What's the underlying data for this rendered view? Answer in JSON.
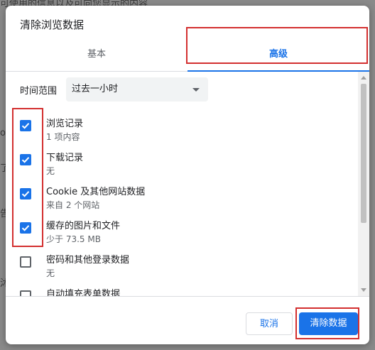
{
  "background": {
    "fragment_top": "可使用的信息以及可向您显示的内容",
    "fragments": [
      "on",
      "了多",
      "告",
      "沐"
    ]
  },
  "dialog": {
    "title": "清除浏览数据",
    "tabs": [
      {
        "label": "基本",
        "active": false
      },
      {
        "label": "高级",
        "active": true
      }
    ],
    "time_range": {
      "label": "时间范围",
      "selected": "过去一小时"
    },
    "items": [
      {
        "title": "浏览记录",
        "subtitle": "1 项内容",
        "checked": true
      },
      {
        "title": "下载记录",
        "subtitle": "无",
        "checked": true
      },
      {
        "title": "Cookie 及其他网站数据",
        "subtitle": "来自 2 个网站",
        "checked": true
      },
      {
        "title": "缓存的图片和文件",
        "subtitle": "少于 73.5 MB",
        "checked": true
      },
      {
        "title": "密码和其他登录数据",
        "subtitle": "无",
        "checked": false
      },
      {
        "title": "自动填充表单数据",
        "subtitle": "",
        "checked": false
      }
    ],
    "buttons": {
      "cancel": "取消",
      "clear": "清除数据"
    }
  },
  "colors": {
    "accent": "#1a73e8",
    "annotation": "#d32f2f"
  }
}
